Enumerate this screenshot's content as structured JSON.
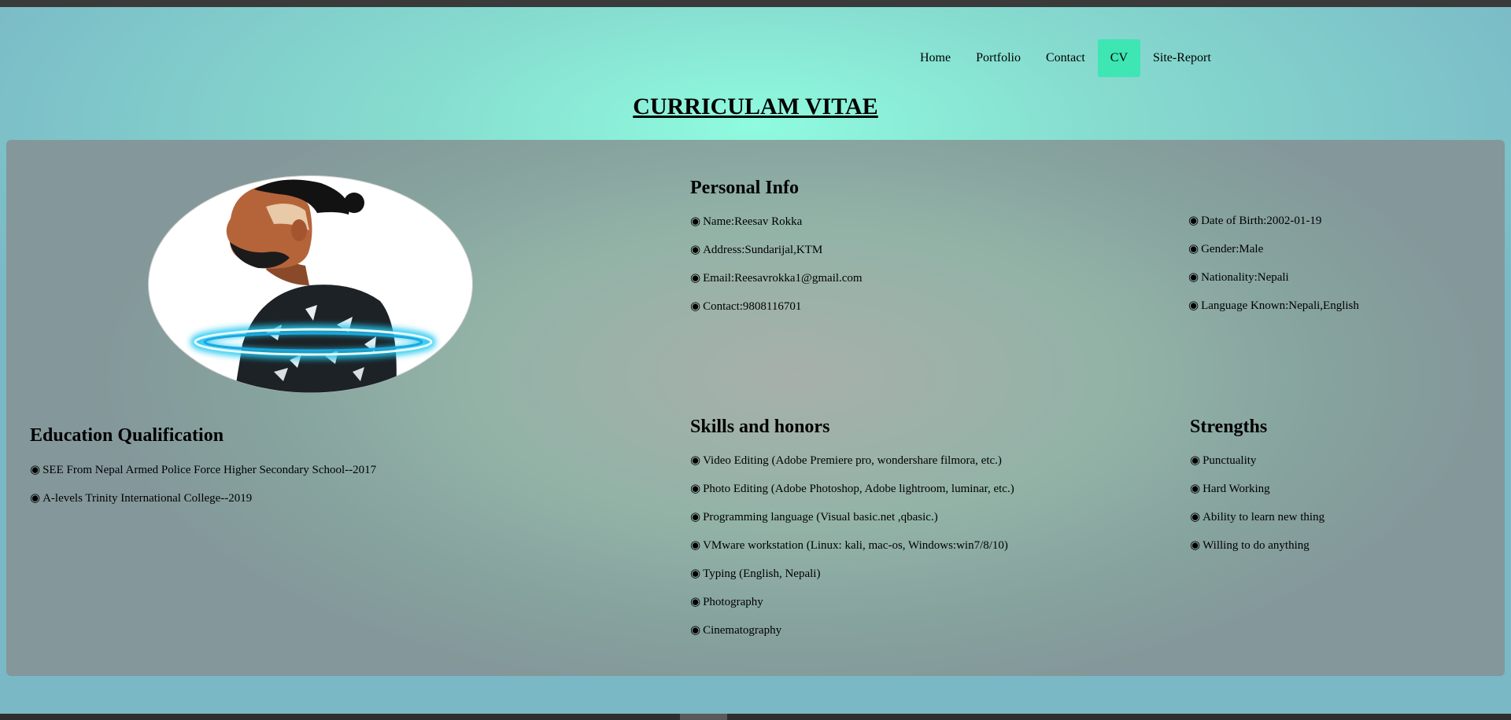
{
  "nav": {
    "items": [
      {
        "label": "Home"
      },
      {
        "label": "Portfolio"
      },
      {
        "label": "Contact"
      },
      {
        "label": "CV",
        "active": true
      },
      {
        "label": "Site-Report"
      }
    ]
  },
  "page": {
    "title": "CURRICULAM VITAE"
  },
  "bullet": "◉",
  "colors": {
    "active_nav": "#3ee6b4",
    "halo": "#22c8f0"
  },
  "education": {
    "heading": "Education Qualification",
    "items": [
      "SEE From Nepal Armed Police Force Higher Secondary School--2017",
      "A-levels Trinity International College--2019"
    ]
  },
  "personal_info": {
    "heading": "Personal Info",
    "left": [
      "Name:Reesav Rokka",
      "Address:Sundarijal,KTM",
      "Email:Reesavrokka1@gmail.com",
      "Contact:9808116701"
    ],
    "right": [
      "Date of Birth:2002-01-19",
      "Gender:Male",
      "Nationality:Nepali",
      "Language Known:Nepali,English"
    ]
  },
  "skills": {
    "heading": "Skills and honors",
    "items": [
      "Video Editing (Adobe Premiere pro, wondershare filmora, etc.)",
      "Photo Editing (Adobe Photoshop, Adobe lightroom, luminar, etc.)",
      "Programming language (Visual basic.net ,qbasic.)",
      "VMware workstation (Linux: kali, mac-os, Windows:win7/8/10)",
      "Typing (English, Nepali)",
      "Photography",
      "Cinematography"
    ]
  },
  "strengths": {
    "heading": "Strengths",
    "items": [
      "Punctuality",
      "Hard Working",
      "Ability to learn new thing",
      "Willing to do anything"
    ]
  }
}
